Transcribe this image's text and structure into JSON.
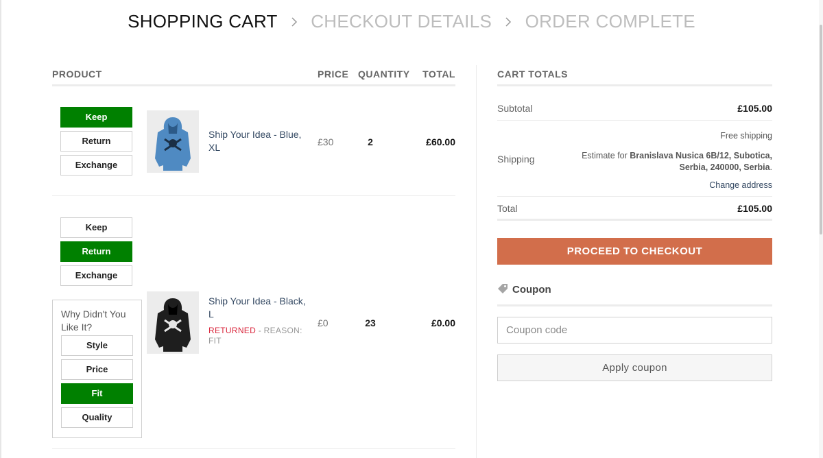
{
  "steps": [
    {
      "label": "SHOPPING CART"
    },
    {
      "label": "CHECKOUT DETAILS"
    },
    {
      "label": "ORDER COMPLETE"
    }
  ],
  "cart": {
    "headers": {
      "product": "PRODUCT",
      "price": "PRICE",
      "quantity": "QUANTITY",
      "total": "TOTAL"
    },
    "items": [
      {
        "actions": {
          "keep": "Keep",
          "return": "Return",
          "exchange": "Exchange"
        },
        "selected_action": "Keep",
        "name": "Ship Your Idea - Blue, XL",
        "price": "£30",
        "quantity": "2",
        "total": "£60.00"
      },
      {
        "actions": {
          "keep": "Keep",
          "return": "Return",
          "exchange": "Exchange"
        },
        "selected_action": "Return",
        "name": "Ship Your Idea - Black, L",
        "status": "RETURNED",
        "reason": " - REASON: FIT",
        "why": {
          "title": "Why Didn't You Like It?",
          "options": {
            "style": "Style",
            "price": "Price",
            "fit": "Fit",
            "quality": "Quality"
          },
          "selected": "Fit"
        },
        "price": "£0",
        "quantity": "23",
        "total": "£0.00"
      }
    ]
  },
  "totals": {
    "title": "CART TOTALS",
    "subtotal_label": "Subtotal",
    "subtotal_value": "£105.00",
    "shipping_label": "Shipping",
    "shipping_method": "Free shipping",
    "estimate_prefix": "Estimate for ",
    "estimate_address": "Branislava Nusica 6B/12, Subotica, Serbia, 240000, Serbia",
    "estimate_suffix": ".",
    "change_address": "Change address",
    "total_label": "Total",
    "total_value": "£105.00",
    "checkout_button": "PROCEED TO CHECKOUT"
  },
  "coupon": {
    "title": "Coupon",
    "placeholder": "Coupon code",
    "apply_button": "Apply coupon"
  },
  "colors": {
    "selected_green": "#008000",
    "checkout_orange": "#d26e4b",
    "link_blue": "#334862",
    "returned_red": "#d9263c"
  },
  "icons": [
    "chevron-right-icon",
    "tag-icon"
  ]
}
